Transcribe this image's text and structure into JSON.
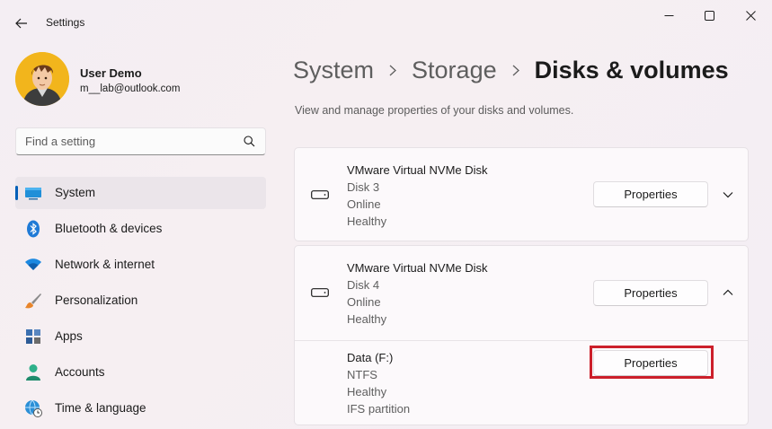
{
  "window": {
    "title": "Settings",
    "icons": {
      "back": "back-arrow-icon",
      "minimize": "minimize-icon",
      "maximize": "maximize-icon",
      "close": "close-icon"
    }
  },
  "profile": {
    "name": "User Demo",
    "email": "m__lab@outlook.com"
  },
  "search": {
    "placeholder": "Find a setting"
  },
  "sidebar": {
    "items": [
      {
        "label": "System",
        "icon": "system-icon",
        "selected": true
      },
      {
        "label": "Bluetooth & devices",
        "icon": "bluetooth-icon"
      },
      {
        "label": "Network & internet",
        "icon": "wifi-icon"
      },
      {
        "label": "Personalization",
        "icon": "paintbrush-icon"
      },
      {
        "label": "Apps",
        "icon": "apps-icon"
      },
      {
        "label": "Accounts",
        "icon": "accounts-icon"
      },
      {
        "label": "Time & language",
        "icon": "time-language-icon"
      }
    ],
    "accent": "#005fb8"
  },
  "breadcrumb": {
    "items": [
      "System",
      "Storage",
      "Disks & volumes"
    ]
  },
  "page": {
    "subtitle": "View and manage properties of your disks and volumes."
  },
  "disks": [
    {
      "name": "VMware Virtual NVMe Disk",
      "disk": "Disk 3",
      "status": "Online",
      "health": "Healthy",
      "button": "Properties",
      "expanded": false
    },
    {
      "name": "VMware Virtual NVMe Disk",
      "disk": "Disk 4",
      "status": "Online",
      "health": "Healthy",
      "button": "Properties",
      "expanded": true,
      "volume": {
        "name": "Data (F:)",
        "filesystem": "NTFS",
        "health": "Healthy",
        "type": "IFS partition",
        "button": "Properties"
      }
    }
  ],
  "highlight_color": "#cc1f2a"
}
